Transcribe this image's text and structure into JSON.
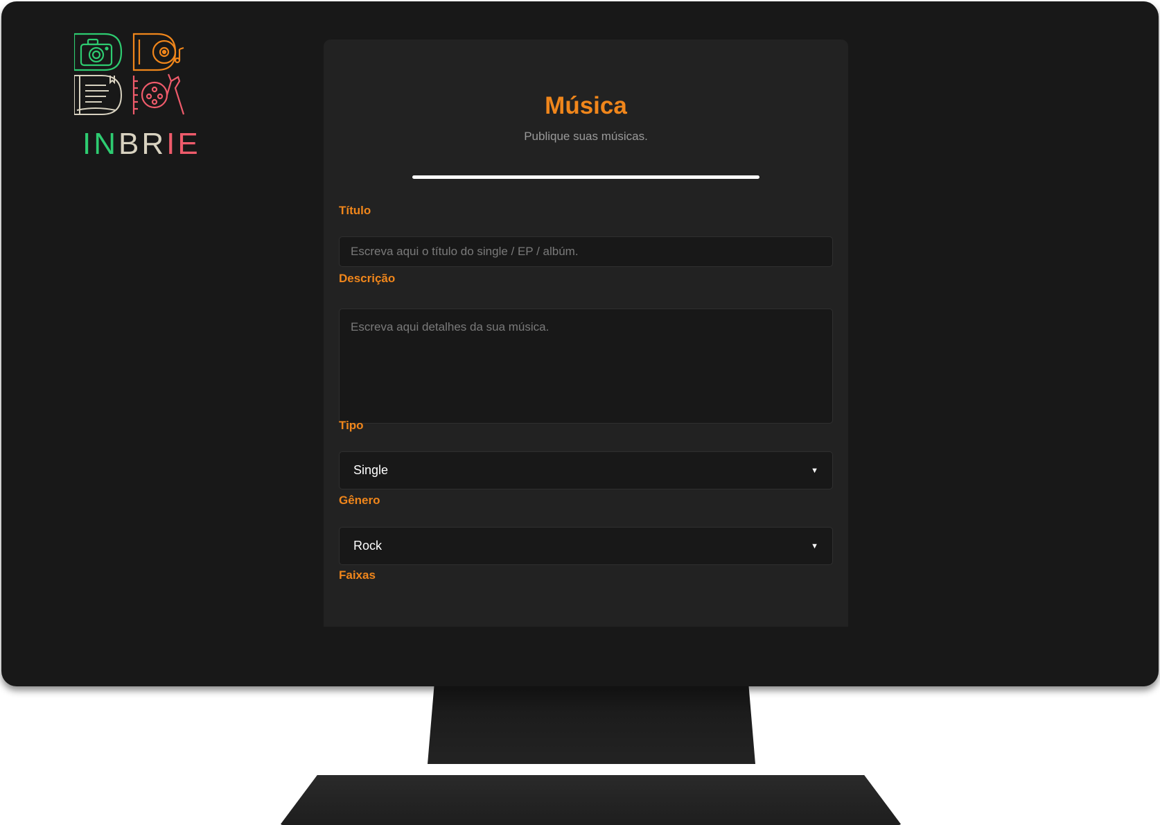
{
  "brand": {
    "wordmark_in": "IN",
    "wordmark_br": "BR",
    "wordmark_ie": "IE",
    "colors": {
      "green": "#2ecc71",
      "orange": "#f0861b",
      "beige": "#d8d2c0",
      "red": "#ef5b6b"
    },
    "icons": [
      "camera-icon",
      "vinyl-music-icon",
      "book-icon",
      "film-reel-icon"
    ]
  },
  "form": {
    "title": "Música",
    "subtitle": "Publique suas músicas.",
    "progress": 1.0,
    "fields": {
      "titulo": {
        "label": "Título",
        "placeholder": "Escreva aqui o título do single / EP / albúm.",
        "value": ""
      },
      "descricao": {
        "label": "Descrição",
        "placeholder": "Escreva aqui detalhes da sua música.",
        "value": ""
      },
      "tipo": {
        "label": "Tipo",
        "selected": "Single"
      },
      "genero": {
        "label": "Gênero",
        "selected": "Rock"
      },
      "faixas": {
        "label": "Faixas"
      }
    },
    "accent_color": "#f0861b",
    "dropdown_icon": "triangle-down-icon"
  }
}
